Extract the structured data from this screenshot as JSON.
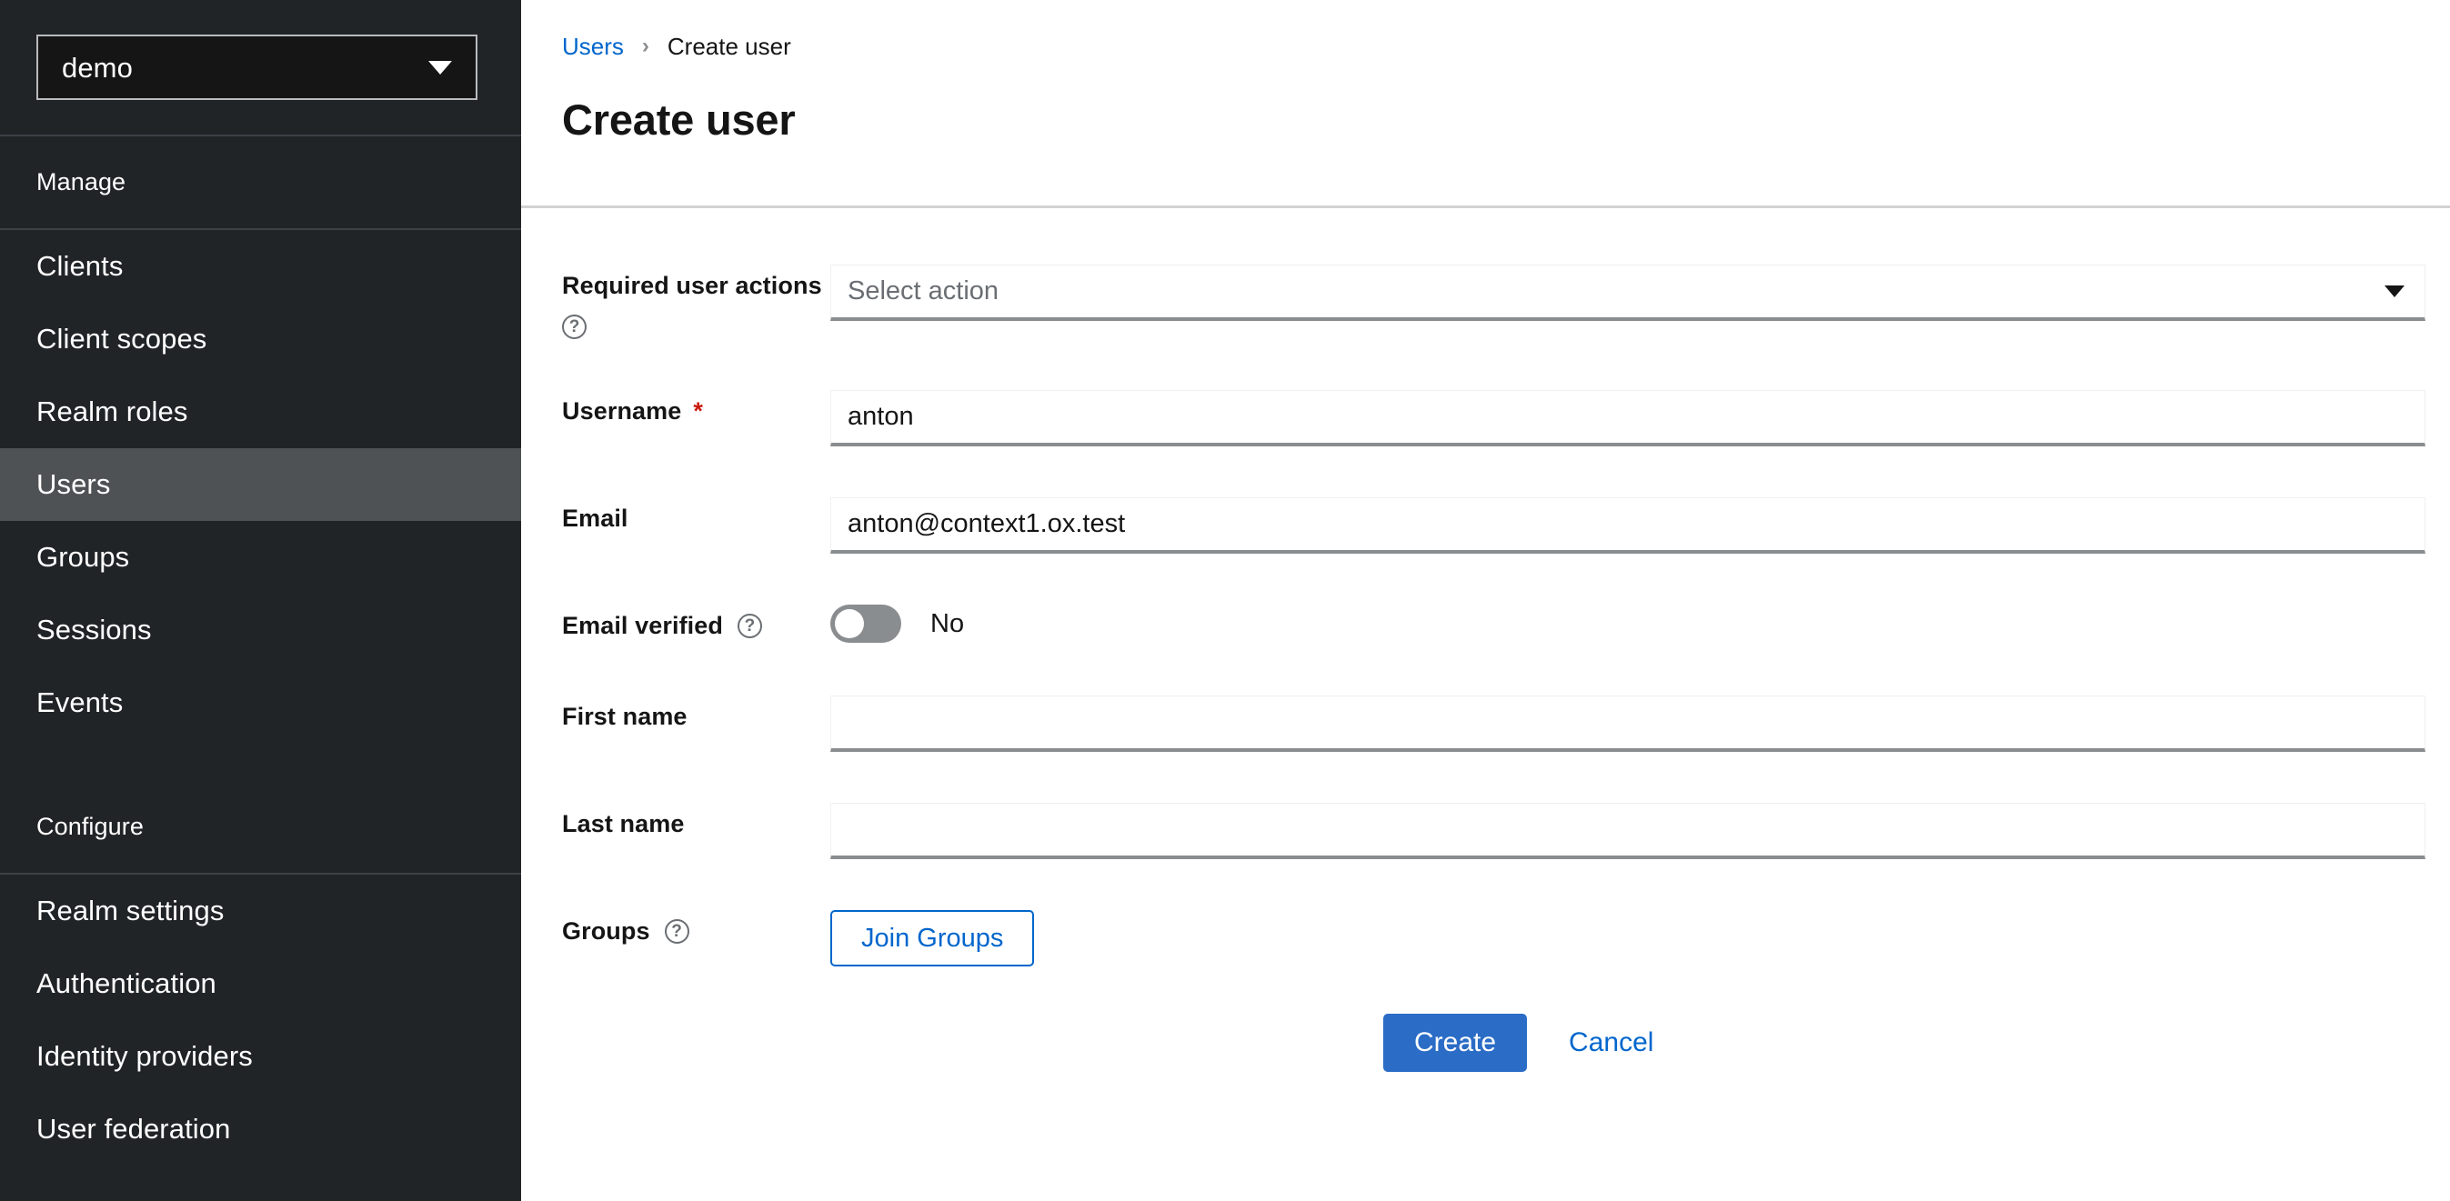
{
  "sidebar": {
    "realm_selector": {
      "value": "demo",
      "caret_icon": "chevron-down-icon"
    },
    "sections": [
      {
        "title": "Manage",
        "items": [
          {
            "label": "Clients",
            "active": false
          },
          {
            "label": "Client scopes",
            "active": false
          },
          {
            "label": "Realm roles",
            "active": false
          },
          {
            "label": "Users",
            "active": true
          },
          {
            "label": "Groups",
            "active": false
          },
          {
            "label": "Sessions",
            "active": false
          },
          {
            "label": "Events",
            "active": false
          }
        ]
      },
      {
        "title": "Configure",
        "items": [
          {
            "label": "Realm settings",
            "active": false
          },
          {
            "label": "Authentication",
            "active": false
          },
          {
            "label": "Identity providers",
            "active": false
          },
          {
            "label": "User federation",
            "active": false
          }
        ]
      }
    ]
  },
  "header": {
    "breadcrumb": {
      "parent": "Users",
      "separator": "›",
      "current": "Create user"
    },
    "title": "Create user"
  },
  "form": {
    "required_user_actions": {
      "label": "Required user actions",
      "help_icon": "help-circle-icon",
      "placeholder": "Select action",
      "value": "",
      "caret_icon": "caret-down-icon"
    },
    "username": {
      "label": "Username",
      "required_marker": "*",
      "value": "anton",
      "placeholder": ""
    },
    "email": {
      "label": "Email",
      "value": "anton@context1.ox.test",
      "placeholder": ""
    },
    "email_verified": {
      "label": "Email verified",
      "help_icon": "help-circle-icon",
      "state_label": "No",
      "on": false
    },
    "first_name": {
      "label": "First name",
      "value": "",
      "placeholder": ""
    },
    "last_name": {
      "label": "Last name",
      "value": "",
      "placeholder": ""
    },
    "groups": {
      "label": "Groups",
      "help_icon": "help-circle-icon",
      "join_button": "Join Groups"
    },
    "actions": {
      "submit": "Create",
      "cancel": "Cancel"
    }
  },
  "colors": {
    "sidebar_bg": "#212427",
    "sidebar_active": "#4f5255",
    "link": "#0066cc",
    "primary": "#2a6cc6",
    "required": "#c9190b",
    "toggle_off": "#8a8d90"
  },
  "help_glyph": "?"
}
